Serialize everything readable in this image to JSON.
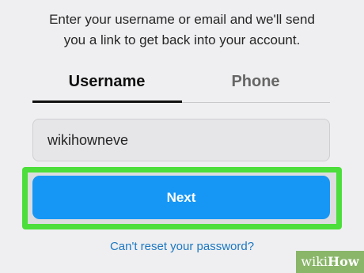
{
  "instructions": "Enter your username or email and we'll send you a link to get back into your account.",
  "tabs": [
    {
      "label": "Username",
      "active": true
    },
    {
      "label": "Phone",
      "active": false
    }
  ],
  "input": {
    "value": "wikihowneve"
  },
  "next_button": {
    "label": "Next"
  },
  "reset_link": "Can't reset your password?",
  "watermark": {
    "wiki": "wiki",
    "how": "How"
  },
  "colors": {
    "accent": "#1697f6",
    "highlight": "#4cde3a",
    "link": "#1b77c2"
  }
}
